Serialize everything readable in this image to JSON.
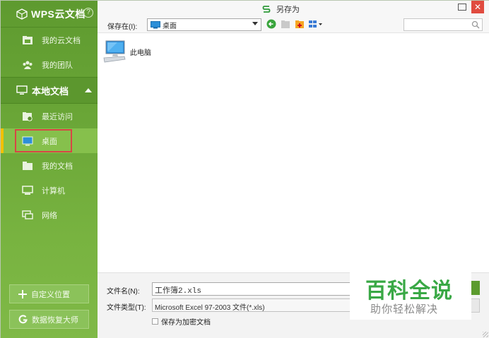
{
  "sidebar": {
    "brand": "WPS云文档",
    "help_glyph": "?",
    "cloud_items": [
      {
        "label": "我的云文档",
        "icon": "cloud-doc-icon"
      },
      {
        "label": "我的团队",
        "icon": "team-icon"
      }
    ],
    "local_section": {
      "label": "本地文档",
      "icon": "monitor-icon"
    },
    "local_items": [
      {
        "label": "最近访问",
        "icon": "recent-folder-icon"
      },
      {
        "label": "桌面",
        "icon": "desktop-icon",
        "active": true
      },
      {
        "label": "我的文档",
        "icon": "folder-icon"
      },
      {
        "label": "计算机",
        "icon": "computer-icon"
      },
      {
        "label": "网络",
        "icon": "network-icon"
      }
    ],
    "buttons": {
      "custom_location": "自定义位置",
      "data_recovery": "数据恢复大师"
    }
  },
  "dialog": {
    "title": "另存为",
    "save_in_label": "保存在(I):",
    "location_value": "桌面",
    "search_placeholder": ""
  },
  "files": [
    {
      "label": "此电脑",
      "icon": "this-pc-icon"
    }
  ],
  "bottom": {
    "filename_label": "文件名(N):",
    "filename_value": "工作簿2.xls",
    "filetype_label": "文件类型(T):",
    "filetype_value": "Microsoft Excel 97-2003 文件(*.xls)",
    "encrypt_label": "保存为加密文档"
  },
  "watermark": {
    "title": "百科全说",
    "subtitle": "助你轻松解决"
  },
  "colors": {
    "sidebar_green": "#6aa637",
    "accent_yellow": "#f3c000",
    "highlight_red": "#d84545",
    "watermark_green": "#39a845",
    "close_red": "#e04b3f"
  }
}
